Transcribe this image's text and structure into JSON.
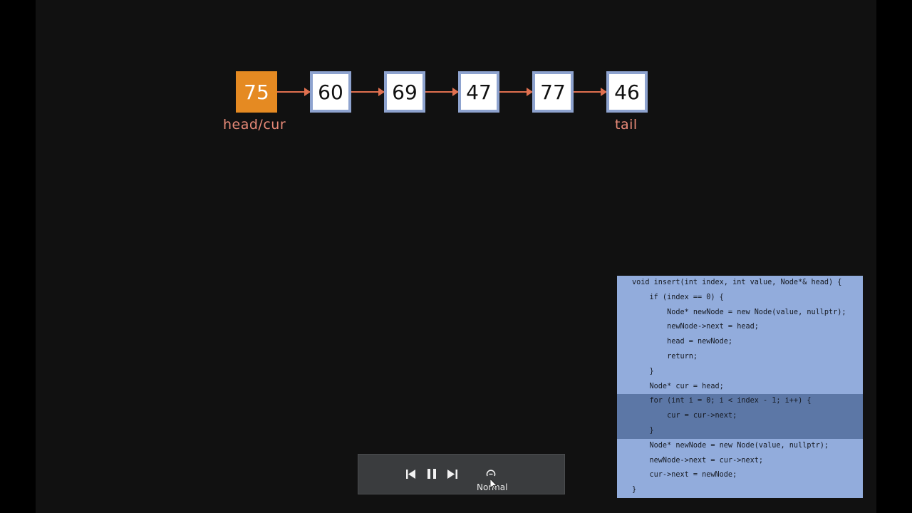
{
  "list": {
    "nodes": [
      {
        "value": "75",
        "state": "current"
      },
      {
        "value": "60",
        "state": "normal"
      },
      {
        "value": "69",
        "state": "normal"
      },
      {
        "value": "47",
        "state": "normal"
      },
      {
        "value": "77",
        "state": "normal"
      },
      {
        "value": "46",
        "state": "normal"
      }
    ],
    "head_label": "head/cur",
    "tail_label": "tail"
  },
  "code": {
    "lines": [
      "void insert(int index, int value, Node*& head) {",
      "    if (index == 0) {",
      "        Node* newNode = new Node(value, nullptr);",
      "        newNode->next = head;",
      "        head = newNode;",
      "        return;",
      "    }",
      "    Node* cur = head;",
      "    for (int i = 0; i < index - 1; i++) {",
      "        cur = cur->next;",
      "    }",
      "    Node* newNode = new Node(value, nullptr);",
      "    newNode->next = cur->next;",
      "    cur->next = newNode;",
      "}"
    ],
    "highlighted_lines": [
      8,
      9,
      10
    ]
  },
  "controls": {
    "speed_label": "Normal",
    "icons": [
      "skip-back-icon",
      "pause-icon",
      "skip-forward-icon",
      "speed-icon"
    ]
  },
  "colors": {
    "current_node": "#e58a22",
    "node_border": "#8ea3cf",
    "arrow": "#e0704f",
    "pointer_label": "#e88a78",
    "code_bg": "#92acdc",
    "code_highlight": "#5c77a6"
  }
}
